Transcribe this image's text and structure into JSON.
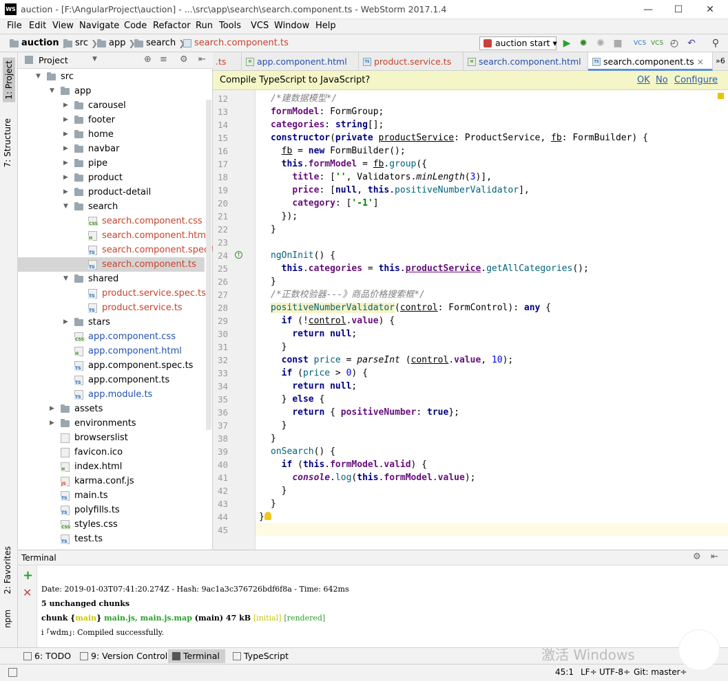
{
  "window": {
    "title": "auction - [F:\\AngularProject\\auction] - ...\\src\\app\\search\\search.component.ts - WebStorm 2017.1.4",
    "icon": "WS"
  },
  "menu": [
    "File",
    "Edit",
    "View",
    "Navigate",
    "Code",
    "Refactor",
    "Run",
    "Tools",
    "VCS",
    "Window",
    "Help"
  ],
  "breadcrumbs": [
    "auction",
    "src",
    "app",
    "search",
    "search.component.ts"
  ],
  "run_config": "auction start",
  "left_tools": {
    "project": "1: Project",
    "structure": "7: Structure",
    "favorites": "2: Favorites",
    "npm": "npm"
  },
  "project_header": "Project",
  "tree": [
    {
      "label": "src",
      "depth": 0,
      "type": "folder",
      "open": true
    },
    {
      "label": "app",
      "depth": 1,
      "type": "folder",
      "open": true
    },
    {
      "label": "carousel",
      "depth": 2,
      "type": "folder"
    },
    {
      "label": "footer",
      "depth": 2,
      "type": "folder"
    },
    {
      "label": "home",
      "depth": 2,
      "type": "folder"
    },
    {
      "label": "navbar",
      "depth": 2,
      "type": "folder"
    },
    {
      "label": "pipe",
      "depth": 2,
      "type": "folder"
    },
    {
      "label": "product",
      "depth": 2,
      "type": "folder"
    },
    {
      "label": "product-detail",
      "depth": 2,
      "type": "folder"
    },
    {
      "label": "search",
      "depth": 2,
      "type": "folder",
      "open": true
    },
    {
      "label": "search.component.css",
      "depth": 3,
      "type": "css",
      "color": "red"
    },
    {
      "label": "search.component.html",
      "depth": 3,
      "type": "html",
      "color": "red"
    },
    {
      "label": "search.component.spec.ts",
      "depth": 3,
      "type": "ts",
      "color": "red"
    },
    {
      "label": "search.component.ts",
      "depth": 3,
      "type": "ts",
      "color": "red",
      "selected": true
    },
    {
      "label": "shared",
      "depth": 2,
      "type": "folder",
      "open": true
    },
    {
      "label": "product.service.spec.ts",
      "depth": 3,
      "type": "ts",
      "color": "red"
    },
    {
      "label": "product.service.ts",
      "depth": 3,
      "type": "ts",
      "color": "red"
    },
    {
      "label": "stars",
      "depth": 2,
      "type": "folder"
    },
    {
      "label": "app.component.css",
      "depth": 2,
      "type": "css",
      "color": "blue"
    },
    {
      "label": "app.component.html",
      "depth": 2,
      "type": "html",
      "color": "blue"
    },
    {
      "label": "app.component.spec.ts",
      "depth": 2,
      "type": "ts"
    },
    {
      "label": "app.component.ts",
      "depth": 2,
      "type": "ts"
    },
    {
      "label": "app.module.ts",
      "depth": 2,
      "type": "ts",
      "color": "blue"
    },
    {
      "label": "assets",
      "depth": 1,
      "type": "folder"
    },
    {
      "label": "environments",
      "depth": 1,
      "type": "folder"
    },
    {
      "label": "browserslist",
      "depth": 1,
      "type": "file"
    },
    {
      "label": "favicon.ico",
      "depth": 1,
      "type": "file"
    },
    {
      "label": "index.html",
      "depth": 1,
      "type": "html"
    },
    {
      "label": "karma.conf.js",
      "depth": 1,
      "type": "js"
    },
    {
      "label": "main.ts",
      "depth": 1,
      "type": "ts"
    },
    {
      "label": "polyfills.ts",
      "depth": 1,
      "type": "ts"
    },
    {
      "label": "styles.css",
      "depth": 1,
      "type": "css"
    },
    {
      "label": "test.ts",
      "depth": 1,
      "type": "ts"
    }
  ],
  "tabs": [
    {
      "label": ".ts",
      "type": "ts"
    },
    {
      "label": "app.component.html",
      "type": "html"
    },
    {
      "label": "product.service.ts",
      "type": "ts"
    },
    {
      "label": "search.component.html",
      "type": "html"
    },
    {
      "label": "search.component.ts",
      "type": "ts",
      "active": true
    }
  ],
  "tab_overflow": "»6",
  "notice": {
    "text": "Compile TypeScript to JavaScript?",
    "ok": "OK",
    "no": "No",
    "configure": "Configure"
  },
  "code_first_line": 12,
  "terminal": {
    "title": "Terminal",
    "line1": "Date: 2019-01-03T07:41:20.274Z - Hash: 9ac1a3c376726bdf6f8a - Time: 642ms",
    "line2": "5 unchanged chunks",
    "line3a": "chunk {",
    "line3b": "main",
    "line3c": "} ",
    "line3d": "main.js, main.js.map",
    "line3e": " (main) 47 kB ",
    "line3f": "[initial]",
    "line3g": " ",
    "line3h": "[rendered]",
    "line4": "i ｢wdm｣: Compiled successfully."
  },
  "bottom_tabs": [
    "6: TODO",
    "9: Version Control",
    "Terminal",
    "TypeScript"
  ],
  "status": {
    "position": "45:1",
    "line_sep": "LF÷",
    "encoding": "UTF-8÷",
    "git": "Git: master÷"
  },
  "watermark": "激活 Windows"
}
